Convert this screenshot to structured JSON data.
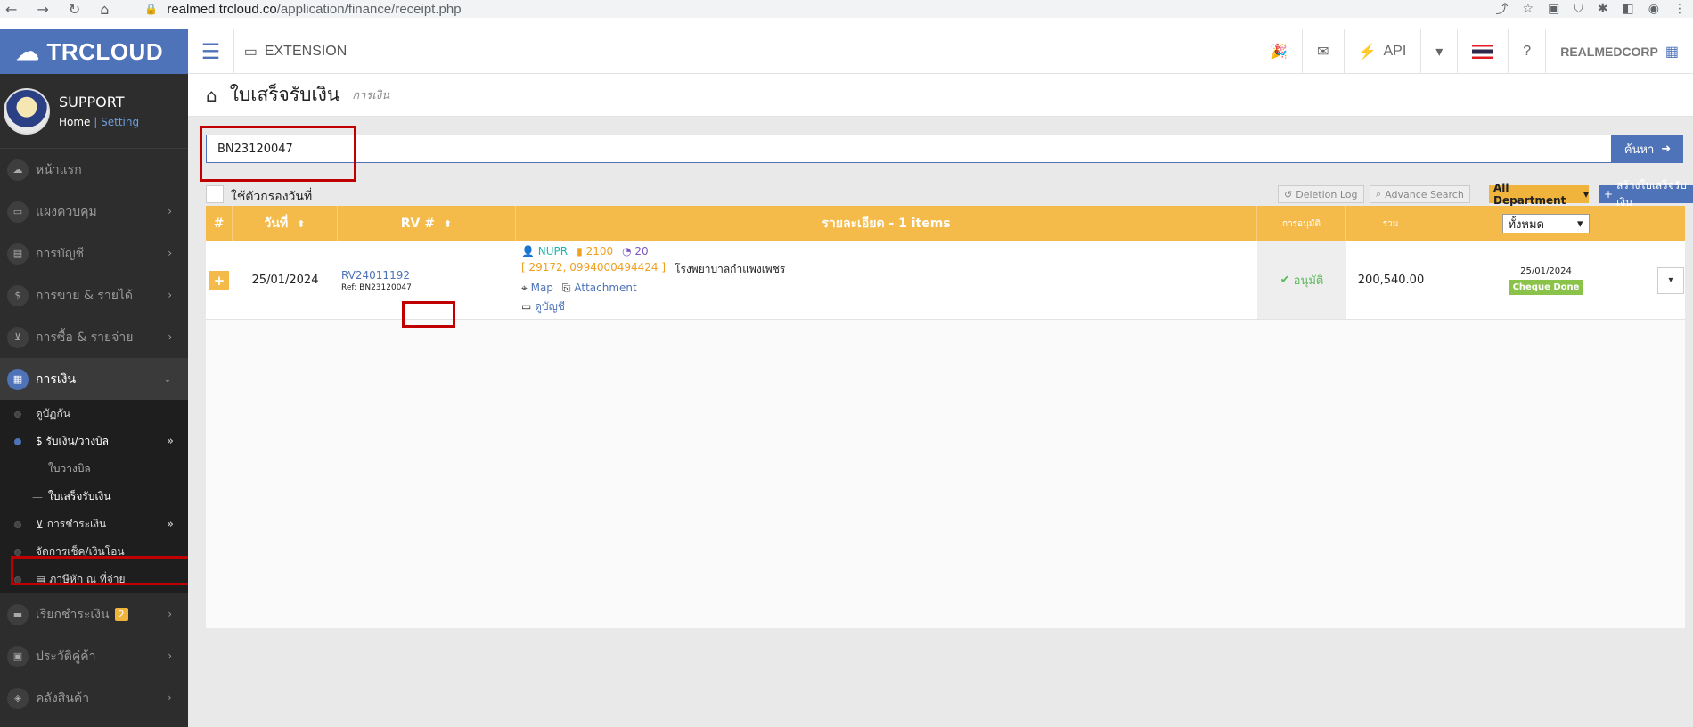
{
  "browser": {
    "url_host": "realmed.trcloud.co",
    "url_path": "/application/finance/receipt.php"
  },
  "topbar": {
    "brand": "TRCLOUD",
    "extension_label": "EXTENSION",
    "api_label": "API",
    "company": "REALMEDCORP"
  },
  "sidebar": {
    "user_name": "SUPPORT",
    "home_link": "Home",
    "separator": "|",
    "setting_link": "Setting",
    "items": [
      {
        "label": "หน้าแรก"
      },
      {
        "label": "แผงควบคุม"
      },
      {
        "label": "การบัญชี"
      },
      {
        "label": "การขาย & รายได้"
      },
      {
        "label": "การซื้อ & รายจ่าย"
      },
      {
        "label": "การเงิน"
      }
    ],
    "finance_sub": [
      {
        "label": "ดูบัฏกัน"
      },
      {
        "label": "$ รับเงิน/วางบิล"
      },
      {
        "label": "ใบวางบิล"
      },
      {
        "label": "ใบเสร็จรับเงิน"
      },
      {
        "label": "การชำระเงิน"
      },
      {
        "label": "จัดการเช็ค/เงินโอน"
      },
      {
        "label": "ภาษีหัก ณ ที่จ่าย"
      }
    ],
    "items_after": [
      {
        "label": "เรียกชำระเงิน",
        "badge": "2"
      },
      {
        "label": "ประวัติคู่ค้า"
      },
      {
        "label": "คลังสินค้า"
      }
    ]
  },
  "page": {
    "title": "ใบเสร็จรับเงิน",
    "subtitle": "การเงิน"
  },
  "search": {
    "value": "BN23120047",
    "button_label": "ค้นหา"
  },
  "filters": {
    "date_filter_label": "ใช้ตัวกรองวันที่",
    "deletion_log": "Deletion Log",
    "advance_search": "Advance Search",
    "department": "All Department",
    "create_button": "สร้างใบเสร็จรับเงิน"
  },
  "table": {
    "headers": {
      "num": "#",
      "date": "วันที่",
      "rv": "RV #",
      "detail": "รายละเอียด - 1 items",
      "approval": "การอนุมัติ",
      "total": "รวม",
      "status_filter": "ทั้งหมด"
    },
    "rows": [
      {
        "date": "25/01/2024",
        "rv": "RV24011192",
        "ref_label": "Ref:",
        "ref": "BN23120047",
        "user": "NUPR",
        "code": "2100",
        "count": "20",
        "customer_ids": "[ 29172, 0994000494424 ]",
        "customer_name": "โรงพยาบาลกำแพงเพชร",
        "map": "Map",
        "attachment": "Attachment",
        "account_link": "ดูบัญชี",
        "approval": "อนุมัติ",
        "total": "200,540.00",
        "status_date": "25/01/2024",
        "status": "Cheque Done"
      }
    ]
  }
}
